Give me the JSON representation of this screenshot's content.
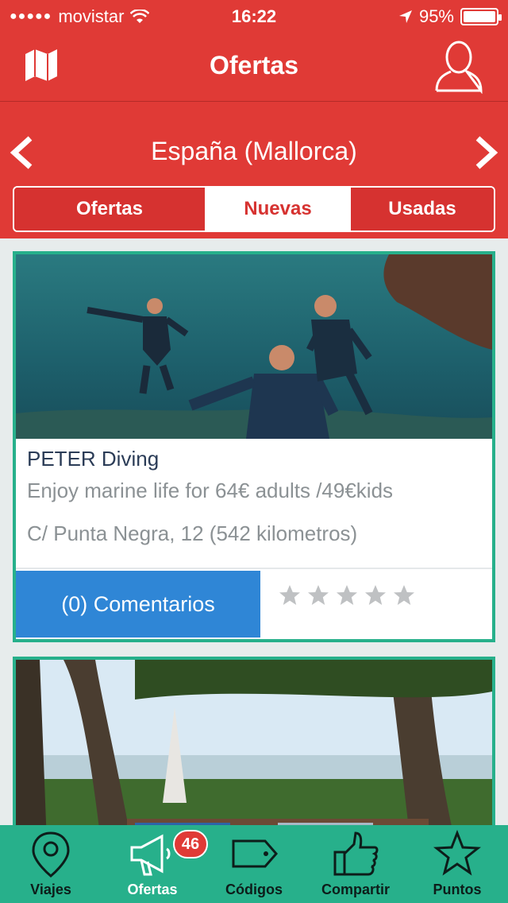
{
  "status": {
    "carrier": "movistar",
    "time": "16:22",
    "battery": "95%",
    "battery_level": 0.95
  },
  "nav": {
    "title": "Ofertas",
    "left_icon": "map-icon",
    "right_icon": "user-icon"
  },
  "region": {
    "label": "España (Mallorca)"
  },
  "segments": [
    {
      "label": "Ofertas",
      "active": false
    },
    {
      "label": "Nuevas",
      "active": true
    },
    {
      "label": "Usadas",
      "active": false
    }
  ],
  "offers": [
    {
      "title": "PETER Diving",
      "subtitle": "Enjoy marine life for 64€ adults /49€kids",
      "address": "C/ Punta Negra, 12 (542 kilometros)",
      "comments_label": "(0) Comentarios",
      "rating": 0,
      "rating_max": 5
    }
  ],
  "tabs": [
    {
      "label": "Viajes",
      "icon": "location-pin-icon"
    },
    {
      "label": "Ofertas",
      "icon": "megaphone-icon",
      "badge": "46"
    },
    {
      "label": "Códigos",
      "icon": "tag-icon"
    },
    {
      "label": "Compartir",
      "icon": "thumbs-up-icon"
    },
    {
      "label": "Puntos",
      "icon": "star-icon"
    }
  ],
  "colors": {
    "header": "#e03a36",
    "accent_green": "#27b08b",
    "button_blue": "#2f86d6"
  }
}
